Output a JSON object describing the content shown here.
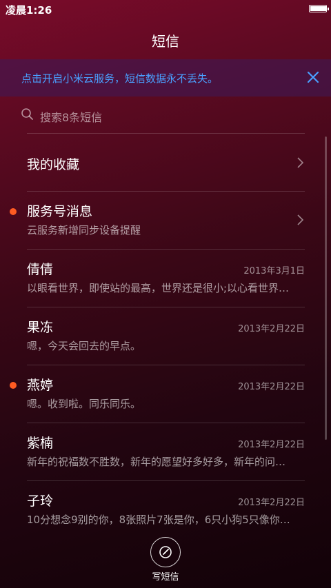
{
  "status_bar": {
    "time": "凌晨1:26"
  },
  "header": {
    "title": "短信"
  },
  "banner": {
    "text": "点击开启小米云服务，短信数据永不丢失。",
    "close_icon": "close-icon"
  },
  "search": {
    "placeholder": "搜索8条短信",
    "icon": "search-icon"
  },
  "conversations": [
    {
      "name": "我的收藏",
      "preview": "",
      "date": "",
      "unread": false,
      "chevron": true
    },
    {
      "name": "服务号消息",
      "preview": "云服务新增同步设备提醒",
      "date": "",
      "unread": true,
      "chevron": true
    },
    {
      "name": "倩倩",
      "preview": "以眼看世界，即使站的最高，世界还是很小;以心看世界…",
      "date": "2013年3月1日",
      "unread": false,
      "chevron": false
    },
    {
      "name": "果冻",
      "preview": "嗯，今天会回去的早点。",
      "date": "2013年2月22日",
      "unread": false,
      "chevron": false
    },
    {
      "name": "燕婷",
      "preview": "嗯。收到啦。同乐同乐。",
      "date": "2013年2月22日",
      "unread": true,
      "chevron": false
    },
    {
      "name": "紫楠",
      "preview": "新年的祝福数不胜数，新年的愿望好多好多，新年的问…",
      "date": "2013年2月22日",
      "unread": false,
      "chevron": false
    },
    {
      "name": "子玲",
      "preview": "10分想念9别的你，8张照片7张是你，6只小狗5只像你…",
      "date": "2013年2月22日",
      "unread": false,
      "chevron": false
    }
  ],
  "compose": {
    "label": "写短信",
    "icon": "compose-icon"
  },
  "colors": {
    "accent_blue": "#4aa0ff",
    "unread_dot": "#ff5b22"
  }
}
